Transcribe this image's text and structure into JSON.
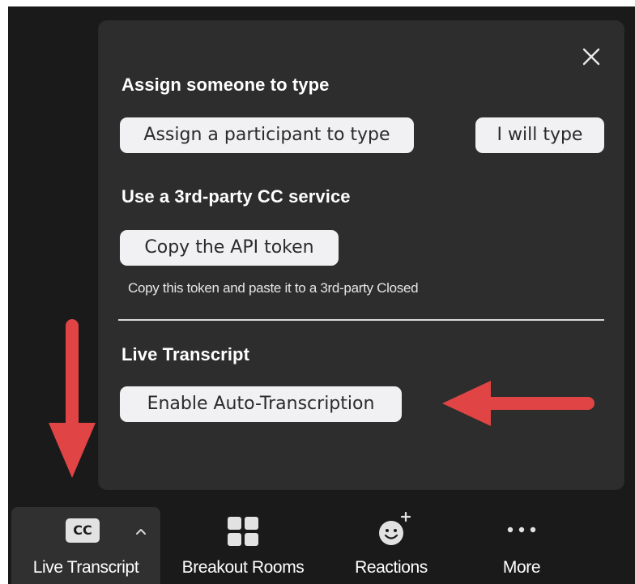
{
  "popup": {
    "sections": [
      {
        "heading": "Assign someone to type",
        "buttons": [
          "Assign a participant to type",
          "I will type"
        ]
      },
      {
        "heading": "Use a 3rd-party CC service",
        "buttons": [
          "Copy the API token"
        ],
        "helper": "Copy this token and paste it to a 3rd-party Closed"
      },
      {
        "heading": "Live Transcript",
        "buttons": [
          "Enable Auto-Transcription"
        ]
      }
    ],
    "close_icon": "close-icon"
  },
  "toolbar": {
    "items": [
      {
        "label": "Live Transcript",
        "icon": "cc-icon",
        "badge": "CC",
        "active": true
      },
      {
        "label": "Breakout Rooms",
        "icon": "breakout-rooms-icon"
      },
      {
        "label": "Reactions",
        "icon": "reactions-icon"
      },
      {
        "label": "More",
        "icon": "more-dots-icon"
      }
    ]
  },
  "annotations": {
    "arrow_color": "#e04444"
  },
  "colors": {
    "popup_bg": "#2d2d2d",
    "button_bg": "#f1f1f3",
    "toolbar_bg": "#1a1a1a",
    "active_item_bg": "#303030"
  }
}
